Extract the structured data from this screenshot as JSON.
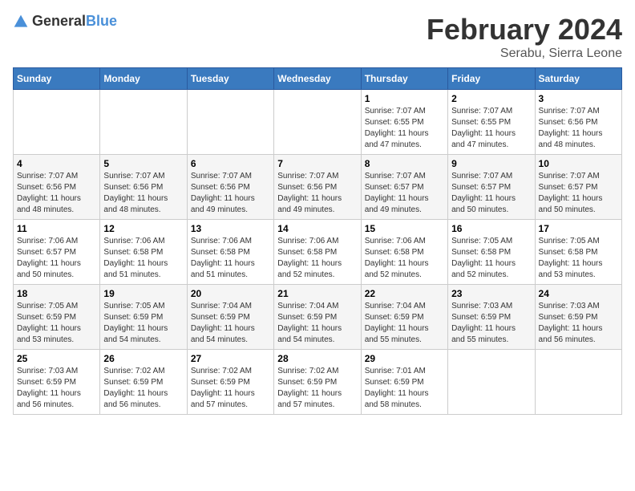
{
  "header": {
    "logo_general": "General",
    "logo_blue": "Blue",
    "title": "February 2024",
    "subtitle": "Serabu, Sierra Leone"
  },
  "weekdays": [
    "Sunday",
    "Monday",
    "Tuesday",
    "Wednesday",
    "Thursday",
    "Friday",
    "Saturday"
  ],
  "weeks": [
    [
      {
        "day": "",
        "info": ""
      },
      {
        "day": "",
        "info": ""
      },
      {
        "day": "",
        "info": ""
      },
      {
        "day": "",
        "info": ""
      },
      {
        "day": "1",
        "info": "Sunrise: 7:07 AM\nSunset: 6:55 PM\nDaylight: 11 hours\nand 47 minutes."
      },
      {
        "day": "2",
        "info": "Sunrise: 7:07 AM\nSunset: 6:55 PM\nDaylight: 11 hours\nand 47 minutes."
      },
      {
        "day": "3",
        "info": "Sunrise: 7:07 AM\nSunset: 6:56 PM\nDaylight: 11 hours\nand 48 minutes."
      }
    ],
    [
      {
        "day": "4",
        "info": "Sunrise: 7:07 AM\nSunset: 6:56 PM\nDaylight: 11 hours\nand 48 minutes."
      },
      {
        "day": "5",
        "info": "Sunrise: 7:07 AM\nSunset: 6:56 PM\nDaylight: 11 hours\nand 48 minutes."
      },
      {
        "day": "6",
        "info": "Sunrise: 7:07 AM\nSunset: 6:56 PM\nDaylight: 11 hours\nand 49 minutes."
      },
      {
        "day": "7",
        "info": "Sunrise: 7:07 AM\nSunset: 6:56 PM\nDaylight: 11 hours\nand 49 minutes."
      },
      {
        "day": "8",
        "info": "Sunrise: 7:07 AM\nSunset: 6:57 PM\nDaylight: 11 hours\nand 49 minutes."
      },
      {
        "day": "9",
        "info": "Sunrise: 7:07 AM\nSunset: 6:57 PM\nDaylight: 11 hours\nand 50 minutes."
      },
      {
        "day": "10",
        "info": "Sunrise: 7:07 AM\nSunset: 6:57 PM\nDaylight: 11 hours\nand 50 minutes."
      }
    ],
    [
      {
        "day": "11",
        "info": "Sunrise: 7:06 AM\nSunset: 6:57 PM\nDaylight: 11 hours\nand 50 minutes."
      },
      {
        "day": "12",
        "info": "Sunrise: 7:06 AM\nSunset: 6:58 PM\nDaylight: 11 hours\nand 51 minutes."
      },
      {
        "day": "13",
        "info": "Sunrise: 7:06 AM\nSunset: 6:58 PM\nDaylight: 11 hours\nand 51 minutes."
      },
      {
        "day": "14",
        "info": "Sunrise: 7:06 AM\nSunset: 6:58 PM\nDaylight: 11 hours\nand 52 minutes."
      },
      {
        "day": "15",
        "info": "Sunrise: 7:06 AM\nSunset: 6:58 PM\nDaylight: 11 hours\nand 52 minutes."
      },
      {
        "day": "16",
        "info": "Sunrise: 7:05 AM\nSunset: 6:58 PM\nDaylight: 11 hours\nand 52 minutes."
      },
      {
        "day": "17",
        "info": "Sunrise: 7:05 AM\nSunset: 6:58 PM\nDaylight: 11 hours\nand 53 minutes."
      }
    ],
    [
      {
        "day": "18",
        "info": "Sunrise: 7:05 AM\nSunset: 6:59 PM\nDaylight: 11 hours\nand 53 minutes."
      },
      {
        "day": "19",
        "info": "Sunrise: 7:05 AM\nSunset: 6:59 PM\nDaylight: 11 hours\nand 54 minutes."
      },
      {
        "day": "20",
        "info": "Sunrise: 7:04 AM\nSunset: 6:59 PM\nDaylight: 11 hours\nand 54 minutes."
      },
      {
        "day": "21",
        "info": "Sunrise: 7:04 AM\nSunset: 6:59 PM\nDaylight: 11 hours\nand 54 minutes."
      },
      {
        "day": "22",
        "info": "Sunrise: 7:04 AM\nSunset: 6:59 PM\nDaylight: 11 hours\nand 55 minutes."
      },
      {
        "day": "23",
        "info": "Sunrise: 7:03 AM\nSunset: 6:59 PM\nDaylight: 11 hours\nand 55 minutes."
      },
      {
        "day": "24",
        "info": "Sunrise: 7:03 AM\nSunset: 6:59 PM\nDaylight: 11 hours\nand 56 minutes."
      }
    ],
    [
      {
        "day": "25",
        "info": "Sunrise: 7:03 AM\nSunset: 6:59 PM\nDaylight: 11 hours\nand 56 minutes."
      },
      {
        "day": "26",
        "info": "Sunrise: 7:02 AM\nSunset: 6:59 PM\nDaylight: 11 hours\nand 56 minutes."
      },
      {
        "day": "27",
        "info": "Sunrise: 7:02 AM\nSunset: 6:59 PM\nDaylight: 11 hours\nand 57 minutes."
      },
      {
        "day": "28",
        "info": "Sunrise: 7:02 AM\nSunset: 6:59 PM\nDaylight: 11 hours\nand 57 minutes."
      },
      {
        "day": "29",
        "info": "Sunrise: 7:01 AM\nSunset: 6:59 PM\nDaylight: 11 hours\nand 58 minutes."
      },
      {
        "day": "",
        "info": ""
      },
      {
        "day": "",
        "info": ""
      }
    ]
  ]
}
